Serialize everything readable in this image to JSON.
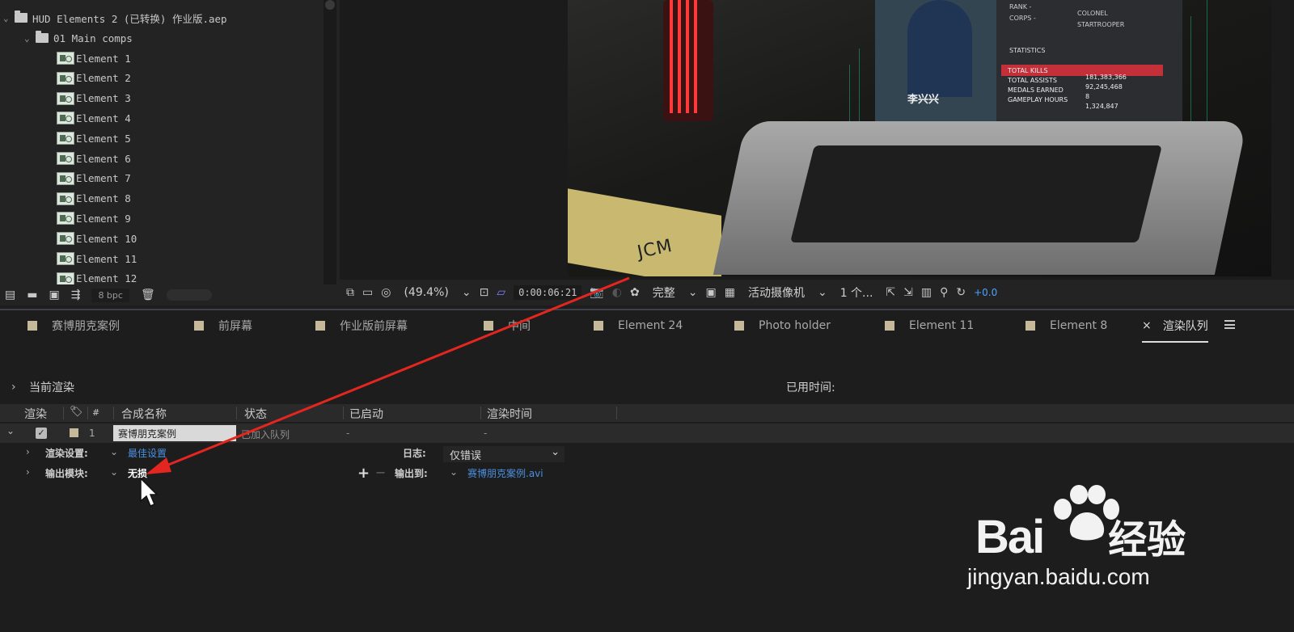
{
  "project": {
    "root_name": "HUD Elements 2 (已转换) 作业版.aep",
    "folder_name": "01 Main comps",
    "items": [
      "Element 1",
      "Element 2",
      "Element 3",
      "Element 4",
      "Element 5",
      "Element 6",
      "Element 7",
      "Element 8",
      "Element 9",
      "Element 10",
      "Element 11",
      "Element 12"
    ],
    "bpc": "8 bpc"
  },
  "preview": {
    "person_name": "李兴兴",
    "stats_heading": "STATISTICS",
    "labels": [
      "RANK -",
      "CORPS -"
    ],
    "values": [
      "COLONEL",
      "STARTROOPER"
    ],
    "stat_lines": [
      "TOTAL KILLS",
      "TOTAL ASSISTS",
      "MEDALS EARNED",
      "GAMEPLAY HOURS"
    ],
    "stat_values": [
      "181,383,366",
      "92,245,468",
      "8",
      "1,324,847"
    ],
    "jcm": "JCM"
  },
  "viewer_toolbar": {
    "zoom": "(49.4%)",
    "time": "0:00:06:21",
    "resolution": "完整",
    "camera": "活动摄像机",
    "views": "1 个...",
    "offset": "+0.0"
  },
  "tabs": [
    "赛博朋克案例",
    "前屏幕",
    "作业版前屏幕",
    "中间",
    "Element 24",
    "Photo holder",
    "Element 11",
    "Element 8",
    "渲染队列"
  ],
  "tab_close": "×",
  "render_queue": {
    "current_render": "当前渲染",
    "elapsed": "已用时间:",
    "columns": [
      "渲染",
      "#",
      "合成名称",
      "状态",
      "已启动",
      "渲染时间"
    ],
    "job": {
      "index": "1",
      "comp_name": "赛博朋克案例",
      "status": "已加入队列",
      "started": "-",
      "render_time": "-"
    },
    "render_settings_label": "渲染设置:",
    "render_settings_value": "最佳设置",
    "log_label": "日志:",
    "log_value": "仅错误",
    "output_module_label": "输出模块:",
    "output_module_value": "无损",
    "output_to_label": "输出到:",
    "output_to_value": "赛博朋克案例.avi"
  },
  "watermark": {
    "brand": "Bai",
    "brand_suffix": "经验",
    "url": "jingyan.baidu.com"
  },
  "colors": {
    "accent_link": "#4a90e2",
    "annotation_arrow": "#e3261f",
    "tab_label": "#c6b99a"
  }
}
